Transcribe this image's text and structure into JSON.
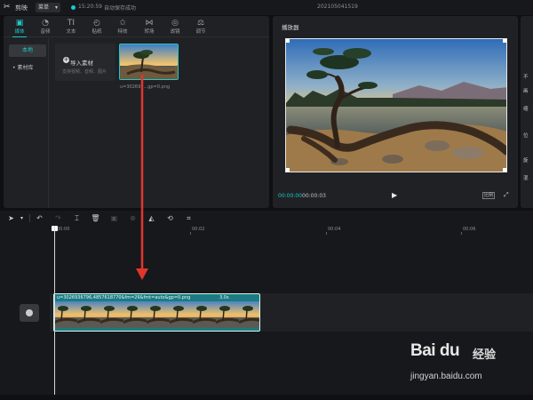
{
  "app": {
    "name": "剪映",
    "menu_label": "菜单",
    "save_time": "15:20:59",
    "save_status": "自动保存成功",
    "project_title": "202105041519"
  },
  "media_toolbar": [
    {
      "label": "媒体",
      "icon": "media-icon",
      "glyph": "▣",
      "active": true
    },
    {
      "label": "音频",
      "icon": "audio-icon",
      "glyph": "◔"
    },
    {
      "label": "文本",
      "icon": "text-icon",
      "glyph": "TI"
    },
    {
      "label": "贴纸",
      "icon": "sticker-icon",
      "glyph": "◴"
    },
    {
      "label": "特效",
      "icon": "effects-icon",
      "glyph": "✩"
    },
    {
      "label": "转场",
      "icon": "transition-icon",
      "glyph": "⋈"
    },
    {
      "label": "滤镜",
      "icon": "filter-icon",
      "glyph": "◎"
    },
    {
      "label": "调节",
      "icon": "adjust-icon",
      "glyph": "⚖"
    }
  ],
  "side_nav": {
    "local": "本地",
    "library": "• 素材库"
  },
  "import": {
    "label": "导入素材",
    "hint": "支持视频、音频、图片"
  },
  "media_item": {
    "name": "u=302693...gp=0.png"
  },
  "player": {
    "title": "播放器",
    "time_current": "00:00:00",
    "time_total": "00:00:03",
    "ratio_label": "比例"
  },
  "properties": {
    "items": [
      "不",
      "画",
      "缩",
      "位",
      "旋",
      "混"
    ]
  },
  "timeline": {
    "ruler_labels": [
      "00:00",
      "00:02",
      "00:04",
      "00:06"
    ],
    "clip_label": "u=3026936796,4857618770&fm=26&fmt=auto&gp=0.png",
    "clip_duration": "3.0s"
  },
  "watermark": {
    "brand": "Bai du",
    "jingyan": "经验",
    "url": "jingyan.baidu.com"
  },
  "colors": {
    "accent": "#1fc8c8",
    "annotation_arrow": "#e0362c"
  }
}
